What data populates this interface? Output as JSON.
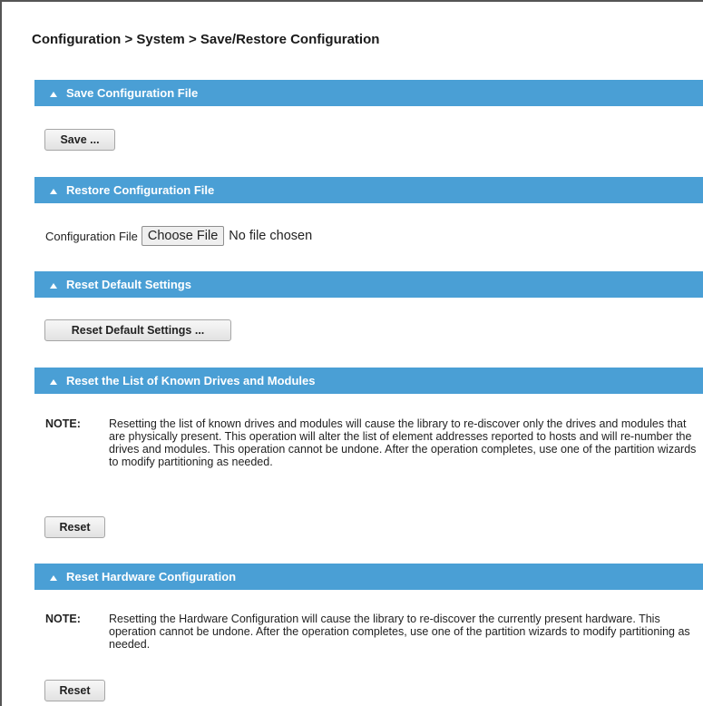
{
  "breadcrumb": "Configuration > System > Save/Restore Configuration",
  "colors": {
    "section_bar": "#4a9fd5",
    "section_text": "#ffffff"
  },
  "sections": {
    "save": {
      "title": "Save Configuration File",
      "button": "Save ..."
    },
    "restore": {
      "title": "Restore Configuration File",
      "field_label": "Configuration File",
      "choose_button": "Choose File",
      "file_status": "No file chosen"
    },
    "reset_defaults": {
      "title": "Reset Default Settings",
      "button": "Reset Default Settings ..."
    },
    "reset_drives": {
      "title": "Reset the List of Known Drives and Modules",
      "note_label": "NOTE:",
      "note_text": "Resetting the list of known drives and modules will cause the library to re-discover only the drives and modules that are physically present. This operation will alter the list of element addresses reported to hosts and will re-number the drives and modules. This operation cannot be undone. After the operation completes, use one of the partition wizards to modify partitioning as needed.",
      "button": "Reset"
    },
    "reset_hardware": {
      "title": "Reset Hardware Configuration",
      "note_label": "NOTE:",
      "note_text": "Resetting the Hardware Configuration will cause the library to re-discover the currently present hardware. This operation cannot be undone. After the operation completes, use one of the partition wizards to modify partitioning as needed.",
      "button": "Reset"
    }
  }
}
